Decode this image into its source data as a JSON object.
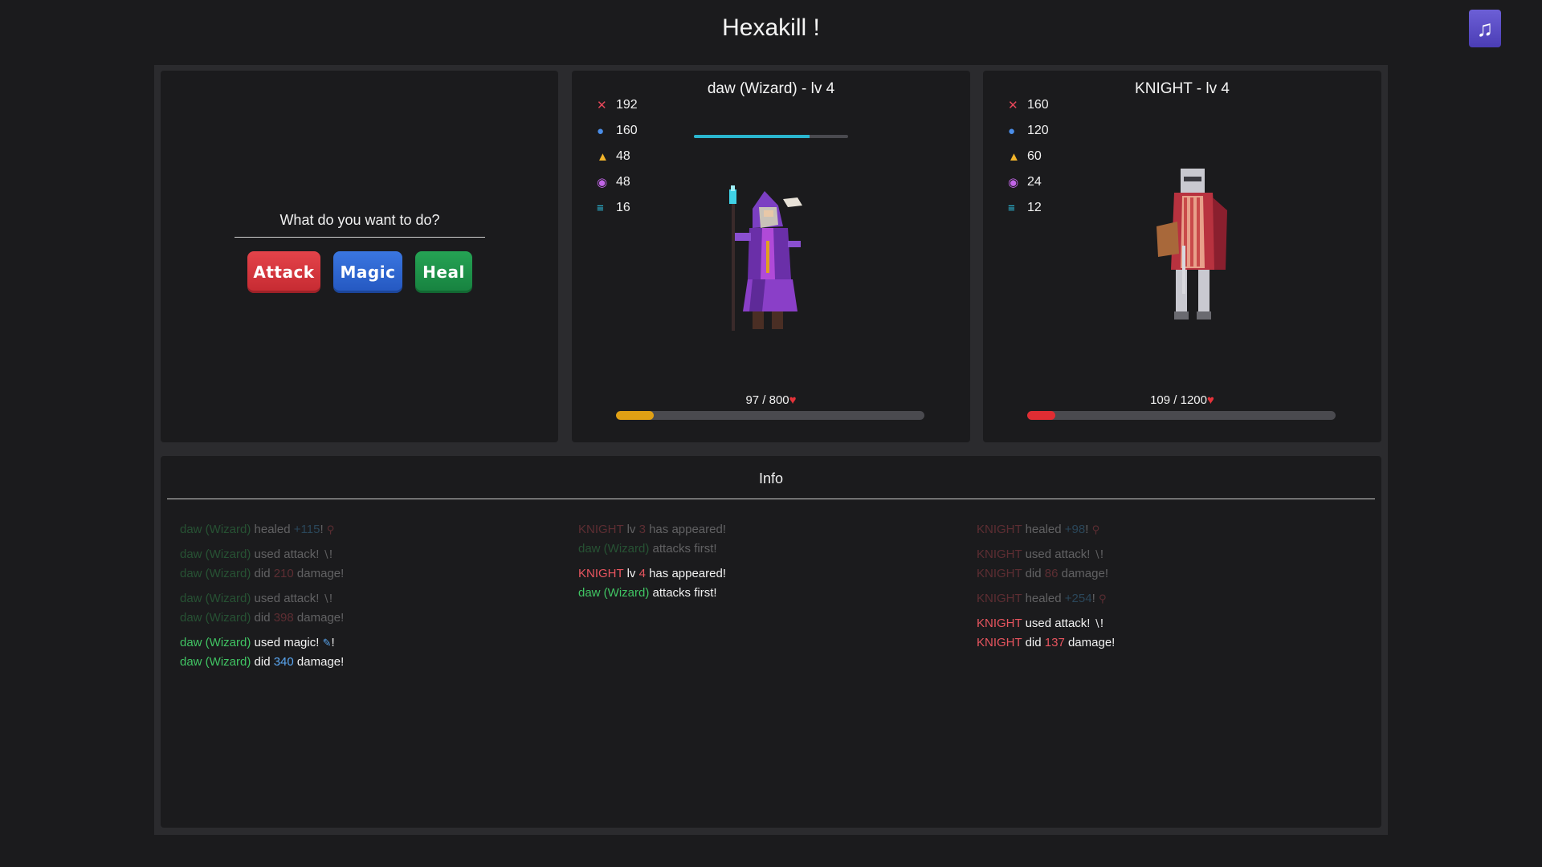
{
  "title": "Hexakill !",
  "music_icon": "music-note-icon",
  "actions": {
    "question": "What do you want to do?",
    "attack_label": "Attack",
    "magic_label": "Magic",
    "heal_label": "Heal"
  },
  "player": {
    "name": "daw (Wizard) - lv 4",
    "stats": {
      "attack": "192",
      "magic": "160",
      "defense": "48",
      "resist": "48",
      "speed": "16"
    },
    "xp_fraction": 0.75,
    "hp_text": "97 / 800",
    "hp_fraction": 0.12125,
    "hp_color": "#e0a014"
  },
  "enemy": {
    "name": "KNIGHT - lv 4",
    "stats": {
      "attack": "160",
      "magic": "120",
      "defense": "60",
      "resist": "24",
      "speed": "12"
    },
    "hp_text": "109 / 1200",
    "hp_fraction": 0.0908,
    "hp_color": "#e02d33"
  },
  "info": {
    "title": "Info",
    "col1": {
      "g1": {
        "l1": {
          "a": "daw (Wizard)",
          "b": " healed ",
          "c": "+115",
          "d": "!"
        }
      },
      "g2": {
        "l1": {
          "a": "daw (Wizard)",
          "b": " used attack! "
        },
        "l2": {
          "a": "daw (Wizard)",
          "b": " did ",
          "c": "210",
          "d": " damage!"
        }
      },
      "g3": {
        "l1": {
          "a": "daw (Wizard)",
          "b": " used attack! "
        },
        "l2": {
          "a": "daw (Wizard)",
          "b": " did ",
          "c": "398",
          "d": " damage!"
        }
      },
      "g4": {
        "l1": {
          "a": "daw (Wizard)",
          "b": " used magic! "
        },
        "l2": {
          "a": "daw (Wizard)",
          "b": " did ",
          "c": "340",
          "d": " damage!"
        }
      }
    },
    "col2": {
      "g1": {
        "l1": {
          "a": "KNIGHT",
          "b": " lv ",
          "c": "3",
          "d": " has appeared!"
        },
        "l2": {
          "a": "daw (Wizard)",
          "b": " attacks first!"
        }
      },
      "g2": {
        "l1": {
          "a": "KNIGHT",
          "b": " lv ",
          "c": "4",
          "d": " has appeared!"
        },
        "l2": {
          "a": "daw (Wizard)",
          "b": " attacks first!"
        }
      }
    },
    "col3": {
      "g1": {
        "l1": {
          "a": "KNIGHT",
          "b": " healed ",
          "c": "+98",
          "d": "!"
        }
      },
      "g2": {
        "l1": {
          "a": "KNIGHT",
          "b": " used attack! "
        },
        "l2": {
          "a": "KNIGHT",
          "b": " did ",
          "c": "86",
          "d": " damage!"
        }
      },
      "g3": {
        "l1": {
          "a": "KNIGHT",
          "b": " healed ",
          "c": "+254",
          "d": "!"
        }
      },
      "g4": {
        "l1": {
          "a": "KNIGHT",
          "b": " used attack! "
        },
        "l2": {
          "a": "KNIGHT",
          "b": " did ",
          "c": "137",
          "d": " damage!"
        }
      }
    }
  }
}
